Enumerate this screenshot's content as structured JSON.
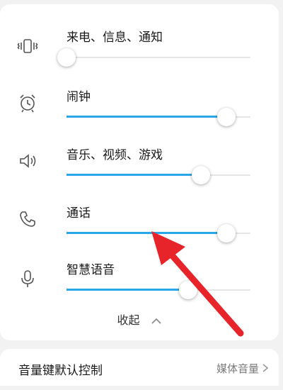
{
  "volume_items": [
    {
      "label": "来电、信息、通知",
      "icon": "vibrate-icon",
      "level": 0.0
    },
    {
      "label": "闹钟",
      "icon": "alarm-clock-icon",
      "level": 0.87
    },
    {
      "label": "音乐、视频、游戏",
      "icon": "speaker-icon",
      "level": 0.73
    },
    {
      "label": "通话",
      "icon": "phone-icon",
      "level": 0.87
    },
    {
      "label": "智慧语音",
      "icon": "microphone-icon",
      "level": 0.66
    }
  ],
  "collapse_label": "收起",
  "default_control": {
    "title": "音量键默认控制",
    "value": "媒体音量"
  },
  "colors": {
    "accent": "#2aa7e8",
    "annotation_arrow": "#e8242b"
  }
}
